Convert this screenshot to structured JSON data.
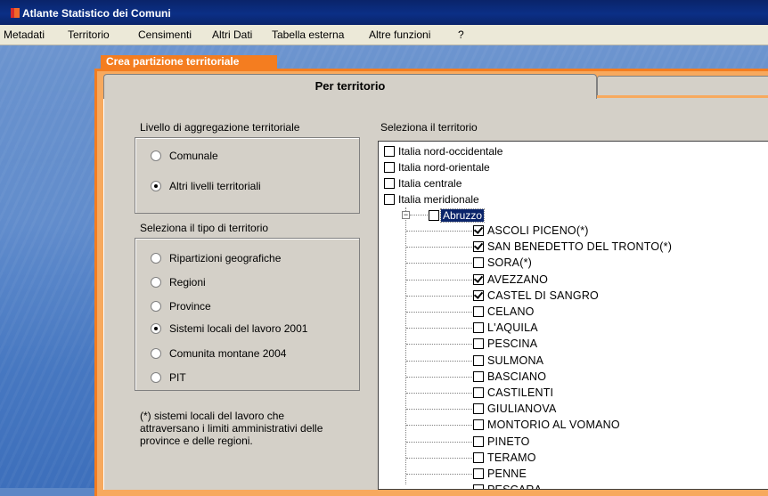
{
  "window": {
    "title": "Atlante Statistico dei Comuni"
  },
  "menu": [
    "Metadati",
    "Territorio",
    "Censimenti",
    "Altri Dati",
    "Tabella esterna",
    "Altre funzioni",
    "?"
  ],
  "panel": {
    "title": "Crea partizione territoriale"
  },
  "tabs": [
    {
      "label": "Per territorio",
      "active": true
    },
    {
      "label": "",
      "active": false
    }
  ],
  "left": {
    "aggregation_label": "Livello di aggregazione territoriale",
    "aggregation_options": [
      {
        "label": "Comunale",
        "selected": false
      },
      {
        "label": "Altri livelli territoriali",
        "selected": true
      }
    ],
    "type_label": "Seleziona il tipo di territorio",
    "type_options": [
      {
        "label": "Ripartizioni geografiche",
        "selected": false
      },
      {
        "label": "Regioni",
        "selected": false
      },
      {
        "label": "Province",
        "selected": false
      },
      {
        "label": "Sistemi locali del lavoro 2001",
        "selected": true
      },
      {
        "label": "Comunita montane 2004",
        "selected": false
      },
      {
        "label": "PIT",
        "selected": false
      }
    ],
    "footnote": [
      "(*) sistemi locali del lavoro che",
      "attraversano i limiti amministrativi delle",
      "province e delle regioni."
    ]
  },
  "right": {
    "label": "Seleziona il territorio",
    "top_items": [
      {
        "label": "Italia nord-occidentale",
        "checked": false
      },
      {
        "label": "Italia nord-orientale",
        "checked": false
      },
      {
        "label": "Italia centrale",
        "checked": false
      },
      {
        "label": "Italia meridionale",
        "checked": false
      }
    ],
    "expanded": {
      "label": "Abruzzo",
      "checked": false,
      "expander": "−"
    },
    "children": [
      {
        "label": "ASCOLI PICENO(*)",
        "checked": true
      },
      {
        "label": "SAN BENEDETTO DEL TRONTO(*)",
        "checked": true
      },
      {
        "label": "SORA(*)",
        "checked": false
      },
      {
        "label": "AVEZZANO",
        "checked": true
      },
      {
        "label": "CASTEL DI SANGRO",
        "checked": true
      },
      {
        "label": "CELANO",
        "checked": false
      },
      {
        "label": "L'AQUILA",
        "checked": false
      },
      {
        "label": "PESCINA",
        "checked": false
      },
      {
        "label": "SULMONA",
        "checked": false
      },
      {
        "label": "BASCIANO",
        "checked": false
      },
      {
        "label": "CASTILENTI",
        "checked": false
      },
      {
        "label": "GIULIANOVA",
        "checked": false
      },
      {
        "label": "MONTORIO AL VOMANO",
        "checked": false
      },
      {
        "label": "PINETO",
        "checked": false
      },
      {
        "label": "TERAMO",
        "checked": false
      },
      {
        "label": "PENNE",
        "checked": false
      },
      {
        "label": "PESCARA",
        "checked": false
      }
    ]
  }
}
